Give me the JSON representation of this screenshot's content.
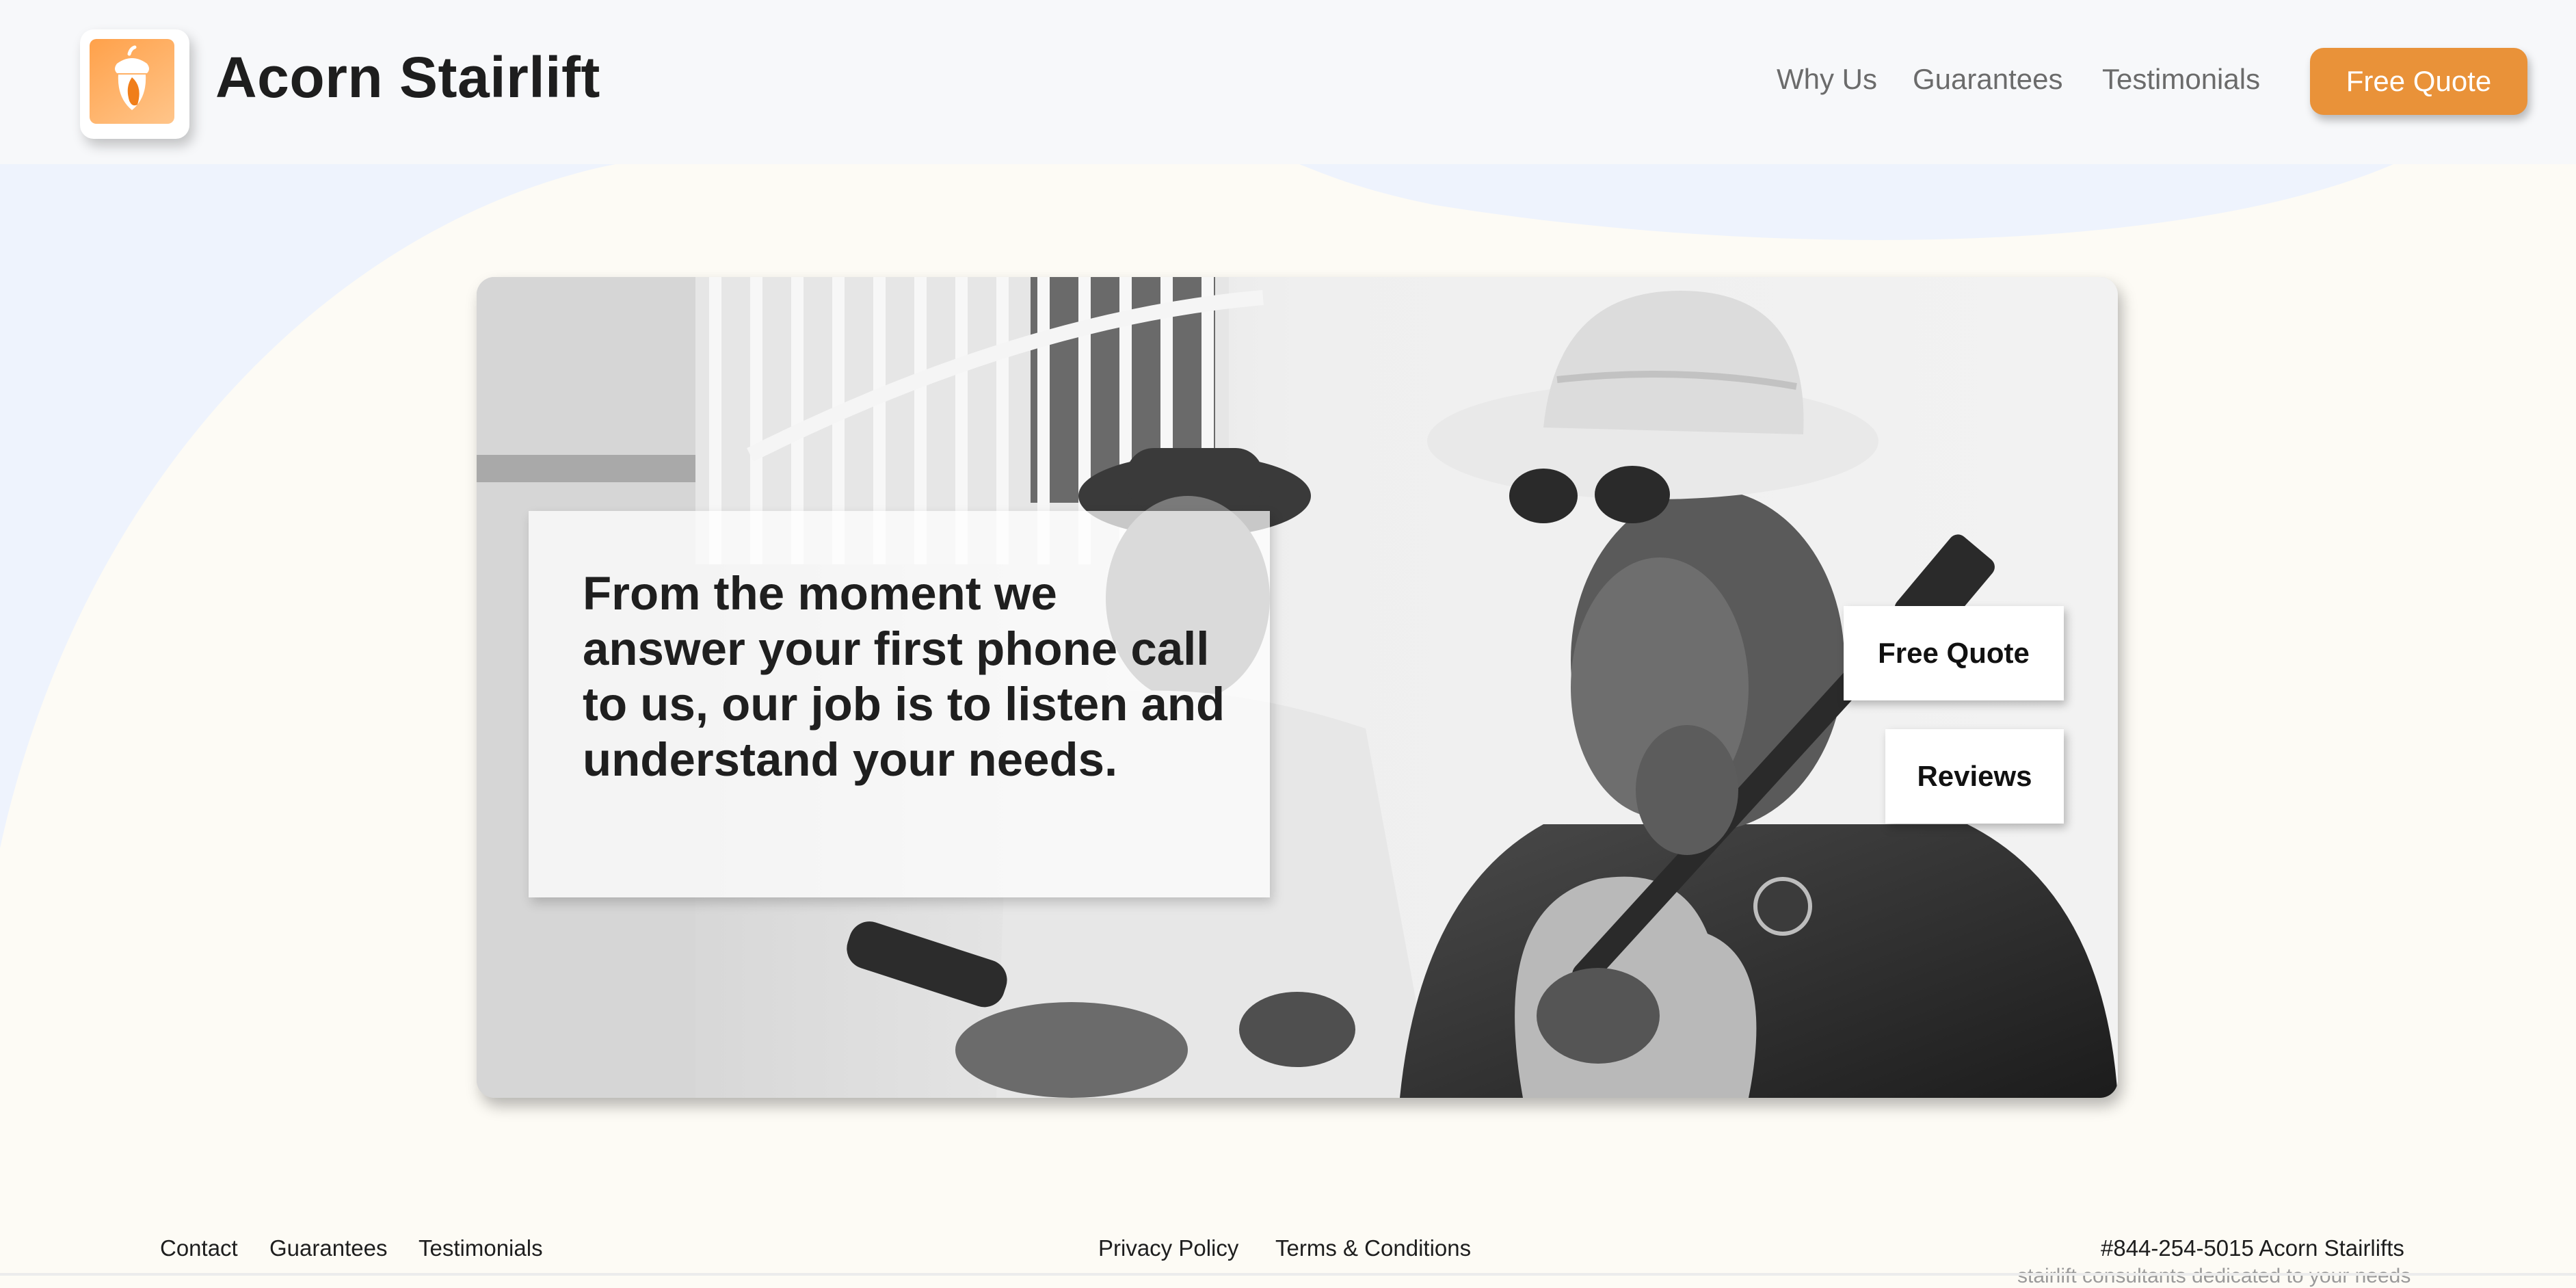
{
  "brand": {
    "name": "Acorn Stairlift",
    "logo_icon": "acorn-icon",
    "colors": {
      "accent": "#e99239",
      "logo_orange": "#ffa14a",
      "page_bg": "#fdfbf5",
      "wave_blue": "#eef3fd"
    }
  },
  "nav": {
    "items": [
      "Why Us",
      "Guarantees",
      "Testimonials"
    ],
    "cta": "Free Quote"
  },
  "hero": {
    "quote": "From the moment we answer your first phone call to us, our job is to listen and understand your needs.",
    "buttons": [
      "Free Quote",
      "Reviews"
    ],
    "image_alt": "Black and white photo of older men playing guitar and percussion"
  },
  "footer": {
    "left_links": [
      "Contact",
      "Guarantees",
      "Testimonials"
    ],
    "center_links": [
      "Privacy Policy",
      "Terms & Conditions"
    ],
    "contact": "#844-254-5015 Acorn Stairlifts",
    "contact_sub": "stairlift consultants dedicated to your needs"
  }
}
